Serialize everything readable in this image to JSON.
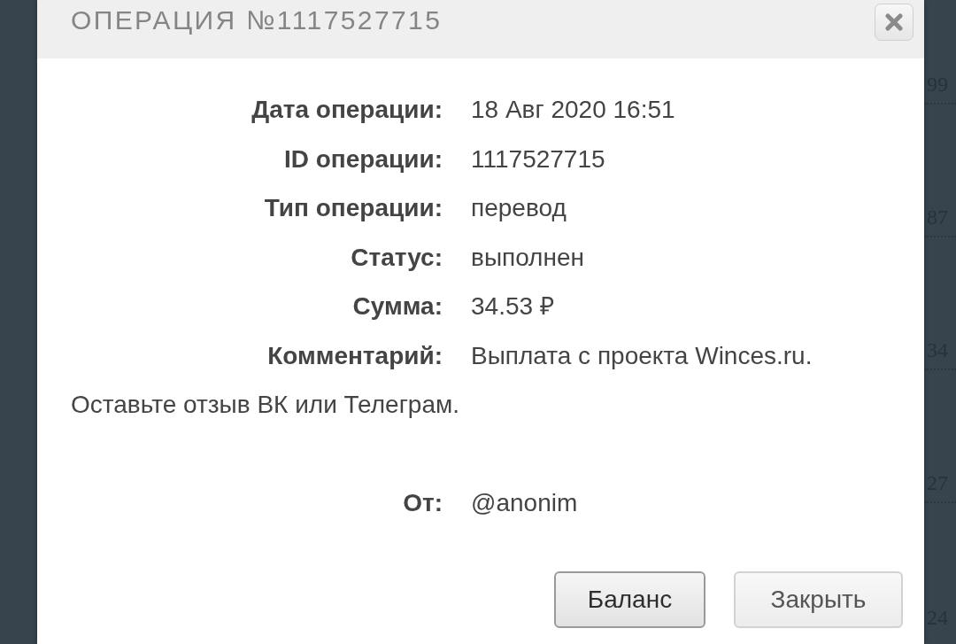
{
  "background": {
    "table_cells": [
      "99",
      "87",
      "34",
      "27",
      "24"
    ]
  },
  "dialog": {
    "title": "ОПЕРАЦИЯ №1117527715",
    "details": [
      {
        "label": "Дата операции:",
        "value": "18 Авг 2020 16:51"
      },
      {
        "label": "ID операции:",
        "value": "1117527715"
      },
      {
        "label": "Тип операции:",
        "value": "перевод"
      },
      {
        "label": "Статус:",
        "value": "выполнен"
      },
      {
        "label": "Сумма:",
        "value": "34.53 ₽"
      },
      {
        "label": "Комментарий:",
        "value": "Выплата с проекта Winces.ru."
      }
    ],
    "message": "Оставьте отзыв ВК или Телеграм.",
    "sender": {
      "label": "От:",
      "value": "@anonim"
    },
    "buttons": [
      {
        "label": "Баланс",
        "focused": true
      },
      {
        "label": "Закрыть",
        "focused": false
      }
    ]
  }
}
